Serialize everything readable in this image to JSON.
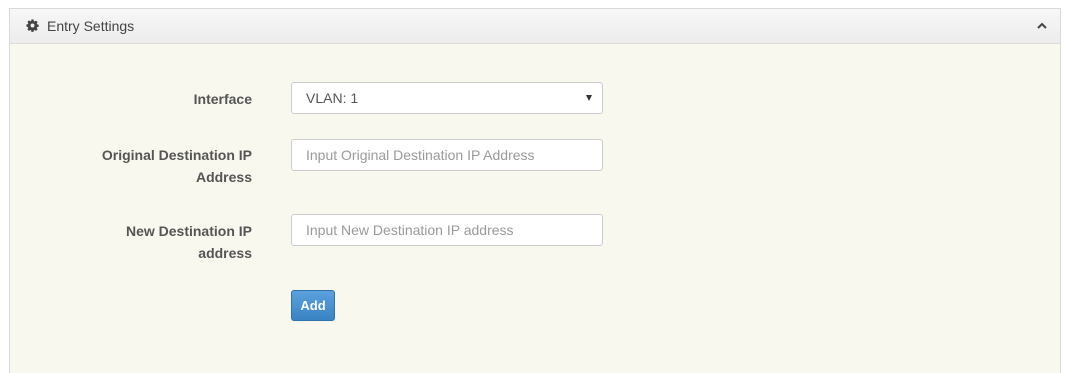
{
  "panel": {
    "title": "Entry Settings",
    "icon": "gear-icon",
    "collapse_icon": "chevron-up-icon"
  },
  "form": {
    "interface": {
      "label": "Interface",
      "selected": "VLAN: 1"
    },
    "original_destination_ip": {
      "label_line1": "Original Destination IP",
      "label_line2": "Address",
      "placeholder": "Input Original Destination IP Address"
    },
    "new_destination_ip": {
      "label_line1": "New Destination IP",
      "label_line2": "address",
      "placeholder": "Input New Destination IP address"
    },
    "add_label": "Add"
  },
  "colors": {
    "panel_background": "#f9f8ef",
    "header_background": "#efefef",
    "button_primary": "#428bca"
  }
}
